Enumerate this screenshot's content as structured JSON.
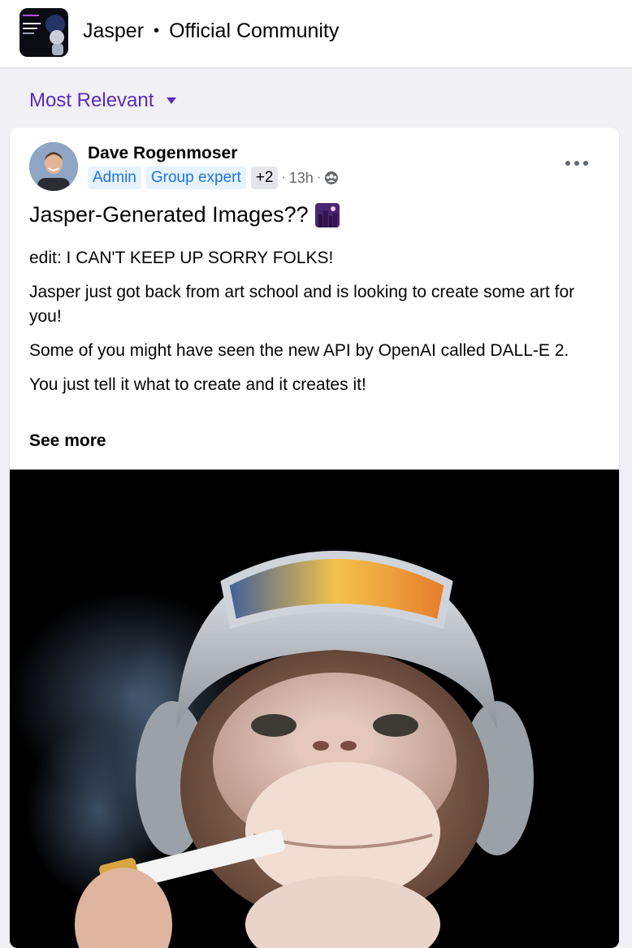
{
  "header": {
    "group_name": "Jasper",
    "separator": "•",
    "group_subtitle": "Official Community",
    "thumb_icon": "group-cover-thumbnail"
  },
  "sort": {
    "label": "Most Relevant",
    "icon": "caret-down-icon",
    "accent_color": "#5b2bb8"
  },
  "post": {
    "author": "Dave Rogenmoser",
    "badges": [
      "Admin",
      "Group expert"
    ],
    "badge_more": "+2",
    "meta_dot": "·",
    "time": "13h",
    "audience_icon": "members-audience-icon",
    "more_icon": "more-options-icon",
    "title": "Jasper-Generated Images??",
    "title_emoji": "night-city-emoji",
    "paragraphs": [
      "edit: I CAN'T KEEP UP SORRY FOLKS!",
      "Jasper just got back from art school and is looking to create some art for you!",
      "Some of you might have seen the new API by OpenAI called DALL-E 2.",
      "You just tell it what to create and it creates it!"
    ],
    "see_more": "See more",
    "image": "ai-generated-monkey-pilot-image"
  }
}
